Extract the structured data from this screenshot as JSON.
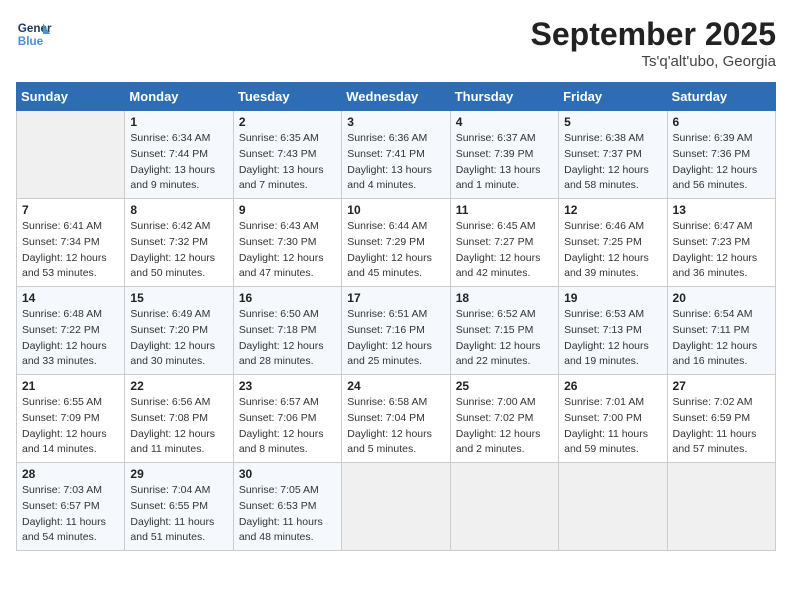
{
  "header": {
    "logo_line1": "General",
    "logo_line2": "Blue",
    "month": "September 2025",
    "location": "Ts'q'alt'ubo, Georgia"
  },
  "days_of_week": [
    "Sunday",
    "Monday",
    "Tuesday",
    "Wednesday",
    "Thursday",
    "Friday",
    "Saturday"
  ],
  "weeks": [
    [
      {
        "day": "",
        "info": ""
      },
      {
        "day": "1",
        "info": "Sunrise: 6:34 AM\nSunset: 7:44 PM\nDaylight: 13 hours\nand 9 minutes."
      },
      {
        "day": "2",
        "info": "Sunrise: 6:35 AM\nSunset: 7:43 PM\nDaylight: 13 hours\nand 7 minutes."
      },
      {
        "day": "3",
        "info": "Sunrise: 6:36 AM\nSunset: 7:41 PM\nDaylight: 13 hours\nand 4 minutes."
      },
      {
        "day": "4",
        "info": "Sunrise: 6:37 AM\nSunset: 7:39 PM\nDaylight: 13 hours\nand 1 minute."
      },
      {
        "day": "5",
        "info": "Sunrise: 6:38 AM\nSunset: 7:37 PM\nDaylight: 12 hours\nand 58 minutes."
      },
      {
        "day": "6",
        "info": "Sunrise: 6:39 AM\nSunset: 7:36 PM\nDaylight: 12 hours\nand 56 minutes."
      }
    ],
    [
      {
        "day": "7",
        "info": "Sunrise: 6:41 AM\nSunset: 7:34 PM\nDaylight: 12 hours\nand 53 minutes."
      },
      {
        "day": "8",
        "info": "Sunrise: 6:42 AM\nSunset: 7:32 PM\nDaylight: 12 hours\nand 50 minutes."
      },
      {
        "day": "9",
        "info": "Sunrise: 6:43 AM\nSunset: 7:30 PM\nDaylight: 12 hours\nand 47 minutes."
      },
      {
        "day": "10",
        "info": "Sunrise: 6:44 AM\nSunset: 7:29 PM\nDaylight: 12 hours\nand 45 minutes."
      },
      {
        "day": "11",
        "info": "Sunrise: 6:45 AM\nSunset: 7:27 PM\nDaylight: 12 hours\nand 42 minutes."
      },
      {
        "day": "12",
        "info": "Sunrise: 6:46 AM\nSunset: 7:25 PM\nDaylight: 12 hours\nand 39 minutes."
      },
      {
        "day": "13",
        "info": "Sunrise: 6:47 AM\nSunset: 7:23 PM\nDaylight: 12 hours\nand 36 minutes."
      }
    ],
    [
      {
        "day": "14",
        "info": "Sunrise: 6:48 AM\nSunset: 7:22 PM\nDaylight: 12 hours\nand 33 minutes."
      },
      {
        "day": "15",
        "info": "Sunrise: 6:49 AM\nSunset: 7:20 PM\nDaylight: 12 hours\nand 30 minutes."
      },
      {
        "day": "16",
        "info": "Sunrise: 6:50 AM\nSunset: 7:18 PM\nDaylight: 12 hours\nand 28 minutes."
      },
      {
        "day": "17",
        "info": "Sunrise: 6:51 AM\nSunset: 7:16 PM\nDaylight: 12 hours\nand 25 minutes."
      },
      {
        "day": "18",
        "info": "Sunrise: 6:52 AM\nSunset: 7:15 PM\nDaylight: 12 hours\nand 22 minutes."
      },
      {
        "day": "19",
        "info": "Sunrise: 6:53 AM\nSunset: 7:13 PM\nDaylight: 12 hours\nand 19 minutes."
      },
      {
        "day": "20",
        "info": "Sunrise: 6:54 AM\nSunset: 7:11 PM\nDaylight: 12 hours\nand 16 minutes."
      }
    ],
    [
      {
        "day": "21",
        "info": "Sunrise: 6:55 AM\nSunset: 7:09 PM\nDaylight: 12 hours\nand 14 minutes."
      },
      {
        "day": "22",
        "info": "Sunrise: 6:56 AM\nSunset: 7:08 PM\nDaylight: 12 hours\nand 11 minutes."
      },
      {
        "day": "23",
        "info": "Sunrise: 6:57 AM\nSunset: 7:06 PM\nDaylight: 12 hours\nand 8 minutes."
      },
      {
        "day": "24",
        "info": "Sunrise: 6:58 AM\nSunset: 7:04 PM\nDaylight: 12 hours\nand 5 minutes."
      },
      {
        "day": "25",
        "info": "Sunrise: 7:00 AM\nSunset: 7:02 PM\nDaylight: 12 hours\nand 2 minutes."
      },
      {
        "day": "26",
        "info": "Sunrise: 7:01 AM\nSunset: 7:00 PM\nDaylight: 11 hours\nand 59 minutes."
      },
      {
        "day": "27",
        "info": "Sunrise: 7:02 AM\nSunset: 6:59 PM\nDaylight: 11 hours\nand 57 minutes."
      }
    ],
    [
      {
        "day": "28",
        "info": "Sunrise: 7:03 AM\nSunset: 6:57 PM\nDaylight: 11 hours\nand 54 minutes."
      },
      {
        "day": "29",
        "info": "Sunrise: 7:04 AM\nSunset: 6:55 PM\nDaylight: 11 hours\nand 51 minutes."
      },
      {
        "day": "30",
        "info": "Sunrise: 7:05 AM\nSunset: 6:53 PM\nDaylight: 11 hours\nand 48 minutes."
      },
      {
        "day": "",
        "info": ""
      },
      {
        "day": "",
        "info": ""
      },
      {
        "day": "",
        "info": ""
      },
      {
        "day": "",
        "info": ""
      }
    ]
  ]
}
